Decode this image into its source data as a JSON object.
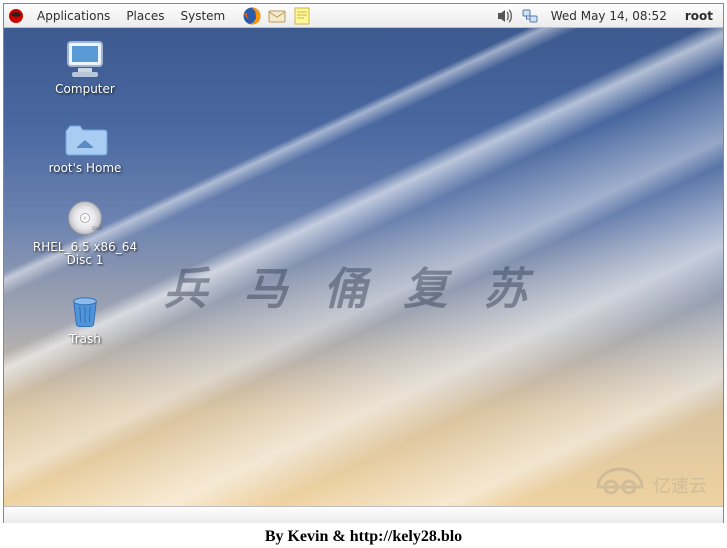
{
  "panel": {
    "menus": {
      "applications": "Applications",
      "places": "Places",
      "system": "System"
    },
    "clock": "Wed May 14, 08:52",
    "user": "root"
  },
  "icons": {
    "redhat": "redhat-logo",
    "firefox": "firefox",
    "email": "evolution-mail",
    "note": "tomboy-notes",
    "volume": "audio-volume",
    "network": "network-manager"
  },
  "desktop": {
    "computer": "Computer",
    "home": "root's Home",
    "disc": "RHEL_6.5 x86_64 Disc 1",
    "trash": "Trash"
  },
  "watermark": "兵马俑复苏",
  "watermark_brand": "亿速云",
  "caption": "By Kevin & http://kely28.blo"
}
